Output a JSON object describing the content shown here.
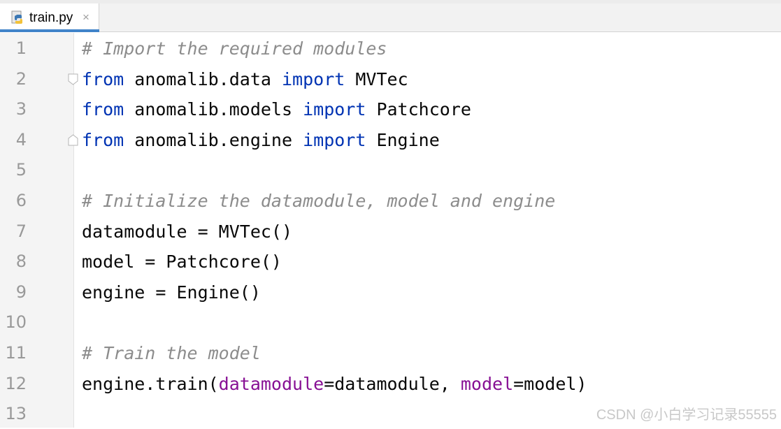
{
  "tab": {
    "filename": "train.py",
    "icon": "python-file-icon",
    "close": "×"
  },
  "lines": [
    {
      "n": "1",
      "parts": [
        {
          "t": "# Import the required modules",
          "c": "cm"
        }
      ]
    },
    {
      "n": "2",
      "parts": [
        {
          "t": "from",
          "c": "kw"
        },
        {
          "t": " anomalib.data ",
          "c": ""
        },
        {
          "t": "import",
          "c": "kw"
        },
        {
          "t": " MVTec",
          "c": ""
        }
      ],
      "fold": "open"
    },
    {
      "n": "3",
      "parts": [
        {
          "t": "from",
          "c": "kw"
        },
        {
          "t": " anomalib.models ",
          "c": ""
        },
        {
          "t": "import",
          "c": "kw"
        },
        {
          "t": " Patchcore",
          "c": ""
        }
      ]
    },
    {
      "n": "4",
      "parts": [
        {
          "t": "from",
          "c": "kw"
        },
        {
          "t": " anomalib.engine ",
          "c": ""
        },
        {
          "t": "import",
          "c": "kw"
        },
        {
          "t": " Engine",
          "c": ""
        }
      ],
      "fold": "close"
    },
    {
      "n": "5",
      "parts": []
    },
    {
      "n": "6",
      "parts": [
        {
          "t": "# Initialize the datamodule, model and engine",
          "c": "cm"
        }
      ]
    },
    {
      "n": "7",
      "parts": [
        {
          "t": "datamodule = MVTec()",
          "c": ""
        }
      ]
    },
    {
      "n": "8",
      "parts": [
        {
          "t": "model = Patchcore()",
          "c": ""
        }
      ]
    },
    {
      "n": "9",
      "parts": [
        {
          "t": "engine = Engine()",
          "c": ""
        }
      ]
    },
    {
      "n": "10",
      "parts": []
    },
    {
      "n": "11",
      "parts": [
        {
          "t": "# Train the model",
          "c": "cm"
        }
      ]
    },
    {
      "n": "12",
      "parts": [
        {
          "t": "engine.train(",
          "c": ""
        },
        {
          "t": "datamodule",
          "c": "pm"
        },
        {
          "t": "=datamodule, ",
          "c": ""
        },
        {
          "t": "model",
          "c": "pm"
        },
        {
          "t": "=model)",
          "c": ""
        }
      ]
    },
    {
      "n": "13",
      "parts": []
    }
  ],
  "watermark": "CSDN @小白学习记录55555",
  "colors": {
    "keyword": "#0033b3",
    "comment": "#8c8c8c",
    "param": "#871094",
    "tab_accent": "#4083c9"
  }
}
